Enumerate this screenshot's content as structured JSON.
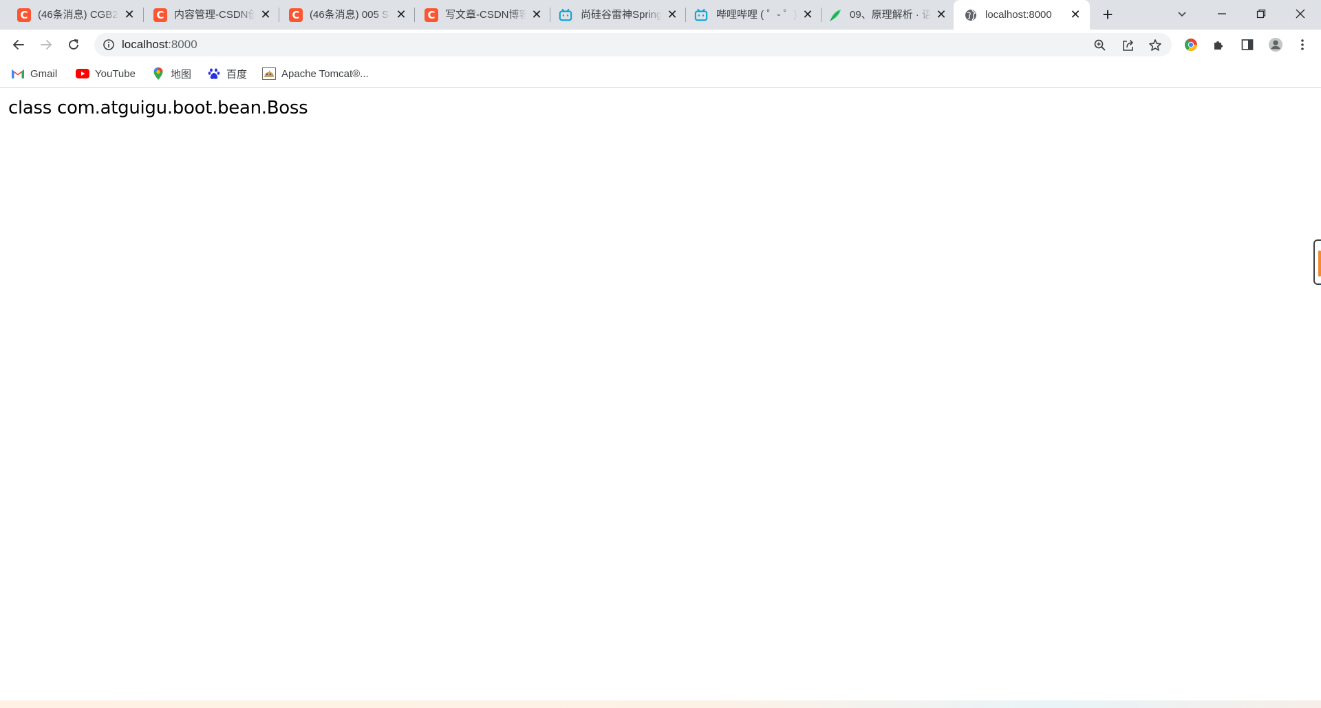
{
  "tabs": [
    {
      "title": "(46条消息) CGB2",
      "favicon": "csdn-icon",
      "close": "✕"
    },
    {
      "title": "内容管理-CSDN创",
      "favicon": "csdn-icon",
      "close": "✕"
    },
    {
      "title": "(46条消息) 005 S",
      "favicon": "csdn-icon",
      "close": "✕"
    },
    {
      "title": "写文章-CSDN博客",
      "favicon": "csdn-icon",
      "close": "✕"
    },
    {
      "title": "尚硅谷雷神Spring",
      "favicon": "bilibili-icon",
      "close": "✕"
    },
    {
      "title": "哔哩哔哩 ( ゜- ゜)",
      "favicon": "bilibili-icon",
      "close": "✕"
    },
    {
      "title": "09、原理解析 · 语",
      "favicon": "leaf-icon",
      "close": "✕"
    },
    {
      "title": "localhost:8000",
      "favicon": "globe-icon",
      "close": "✕",
      "active": true
    }
  ],
  "toolbar": {
    "url_host": "localhost",
    "url_port": ":8000"
  },
  "bookmarks": [
    {
      "label": "Gmail",
      "icon": "gmail-icon"
    },
    {
      "label": "YouTube",
      "icon": "youtube-icon"
    },
    {
      "label": "地图",
      "icon": "maps-icon"
    },
    {
      "label": "百度",
      "icon": "baidu-icon"
    },
    {
      "label": "Apache Tomcat®...",
      "icon": "tomcat-icon"
    }
  ],
  "page": {
    "text": "class com.atguigu.boot.bean.Boss"
  },
  "colors": {
    "csdn": "#fc5531",
    "bilibili": "#00a1d6",
    "tabstrip": "#dee1e6"
  }
}
